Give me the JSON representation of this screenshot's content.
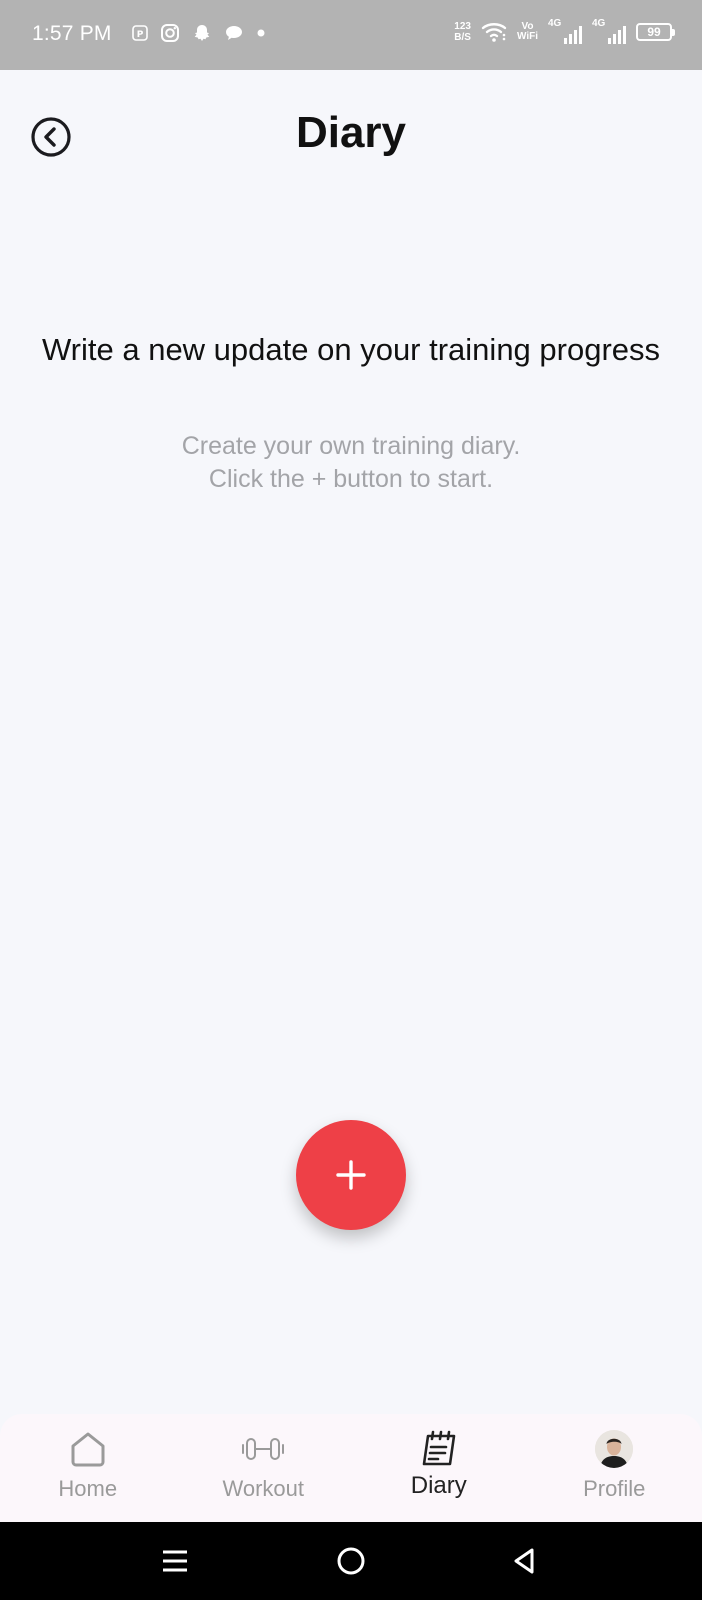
{
  "status_bar": {
    "time": "1:57 PM",
    "left_icons": [
      "paytm-icon",
      "instagram-icon",
      "snapchat-icon",
      "chat-bubble-icon",
      "dot-icon"
    ],
    "speed_value": "123",
    "speed_unit": "B/S",
    "vowifi_top": "Vo",
    "vowifi_bottom": "WiFi",
    "signal_1_label": "4G",
    "signal_2_label": "4G",
    "battery_level": "99"
  },
  "header": {
    "title": "Diary",
    "back_icon": "back-circle-icon"
  },
  "empty_state": {
    "heading": "Write a new update on your training progress",
    "subtitle_line1": "Create your own training diary.",
    "subtitle_line2": "Click the + button to start."
  },
  "fab": {
    "icon": "plus-icon",
    "color": "#ee4047"
  },
  "bottom_nav": {
    "items": [
      {
        "label": "Home",
        "icon": "home-icon",
        "active": false
      },
      {
        "label": "Workout",
        "icon": "dumbbell-icon",
        "active": false
      },
      {
        "label": "Diary",
        "icon": "diary-icon",
        "active": true
      },
      {
        "label": "Profile",
        "icon": "avatar",
        "active": false
      }
    ]
  },
  "system_nav": {
    "buttons": [
      "menu-icon",
      "home-circle-icon",
      "back-triangle-icon"
    ]
  },
  "colors": {
    "background": "#f6f7fb",
    "status_bar": "#b3b3b3",
    "accent": "#ee4047",
    "muted_text": "#a3a4a8"
  }
}
